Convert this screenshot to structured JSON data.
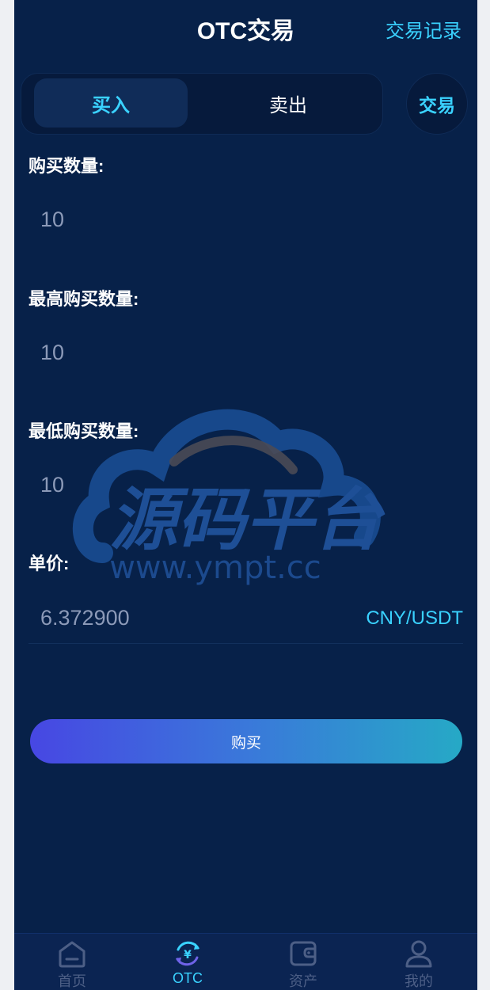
{
  "header": {
    "title": "OTC交易",
    "records_link": "交易记录"
  },
  "tabs": {
    "buy": "买入",
    "sell": "卖出"
  },
  "trade_button": "交易",
  "form": {
    "quantity_label": "购买数量:",
    "quantity_value": "10",
    "max_label": "最高购买数量:",
    "max_value": "10",
    "min_label": "最低购买数量:",
    "min_value": "10",
    "price_label": "单价:",
    "price_value": "6.372900",
    "price_unit": "CNY/USDT"
  },
  "buy_button": "购买",
  "watermark": {
    "brand": "源码平台",
    "url": "www.ympt.cc"
  },
  "tabbar": {
    "items": [
      {
        "label": "首页",
        "icon": "home-icon"
      },
      {
        "label": "OTC",
        "icon": "otc-yuan-icon"
      },
      {
        "label": "资产",
        "icon": "wallet-icon"
      },
      {
        "label": "我的",
        "icon": "user-icon"
      }
    ],
    "active_index": 1
  },
  "colors": {
    "background": "#072149",
    "accent": "#3ad2ff",
    "button_gradient_start": "#4747e3",
    "button_gradient_end": "#26a9c6"
  }
}
